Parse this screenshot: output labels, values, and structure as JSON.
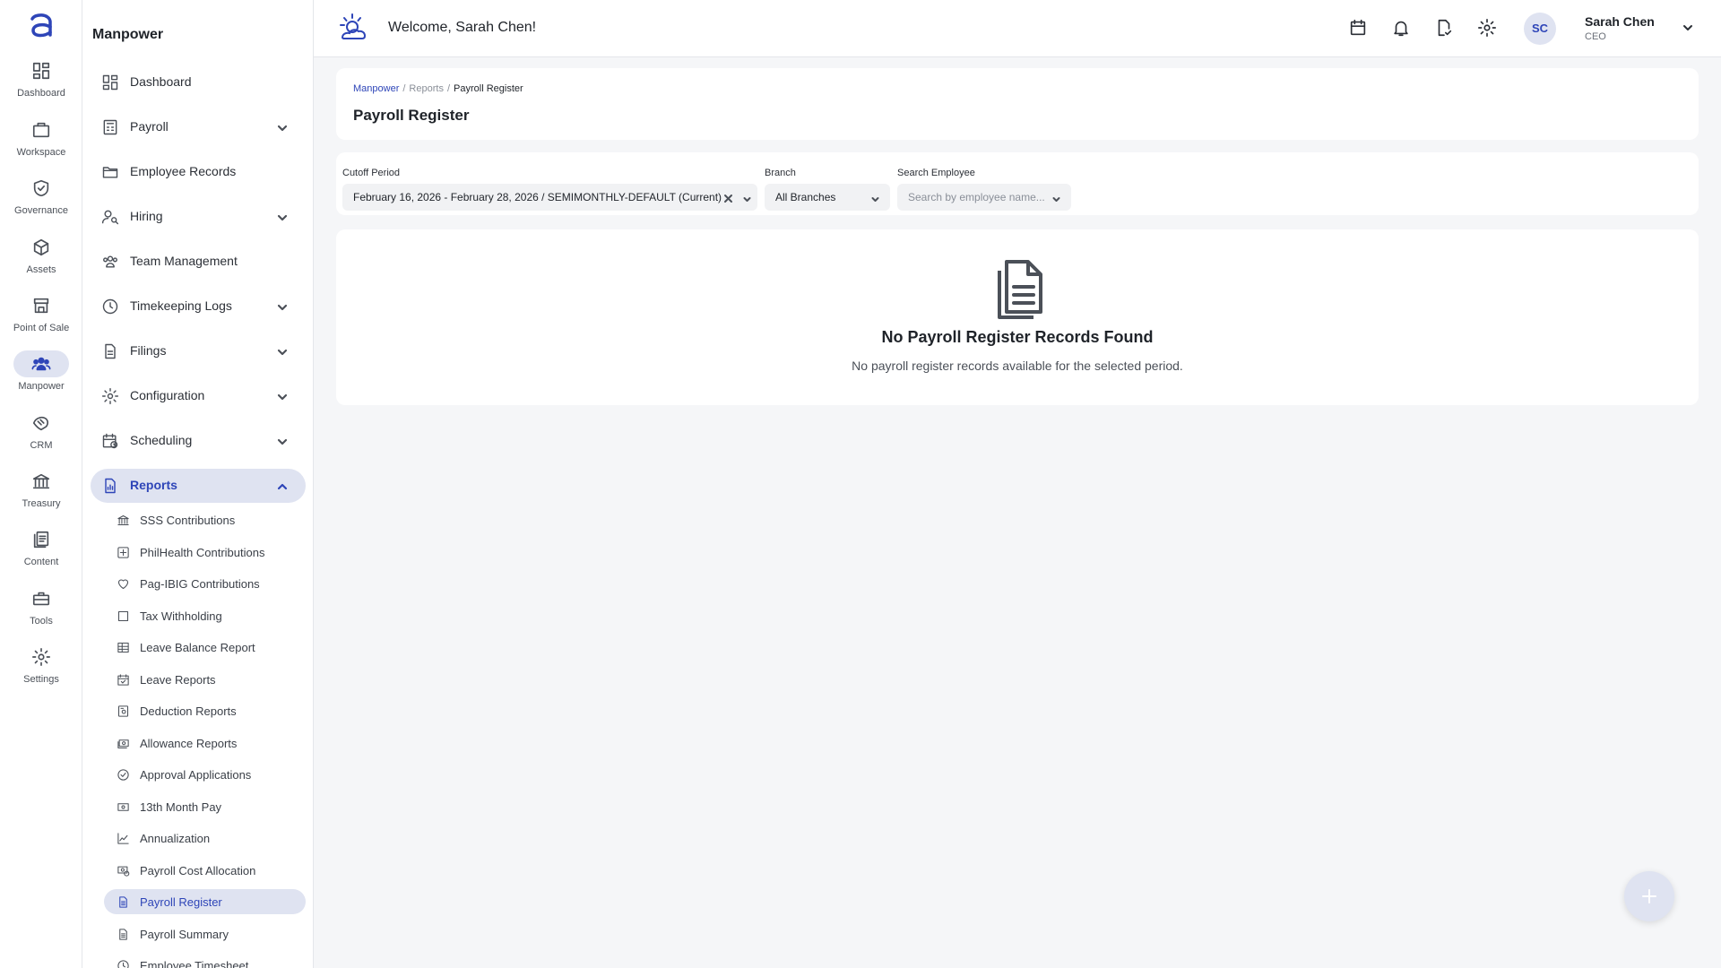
{
  "rail": {
    "items": [
      {
        "label": "Dashboard",
        "icon": "dashboard-icon"
      },
      {
        "label": "Workspace",
        "icon": "briefcase-icon"
      },
      {
        "label": "Governance",
        "icon": "shield-check-icon"
      },
      {
        "label": "Assets",
        "icon": "cube-icon"
      },
      {
        "label": "Point of Sale",
        "icon": "store-icon"
      },
      {
        "label": "Manpower",
        "icon": "people-icon"
      },
      {
        "label": "CRM",
        "icon": "handshake-icon"
      },
      {
        "label": "Treasury",
        "icon": "bank-icon"
      },
      {
        "label": "Content",
        "icon": "documents-icon"
      },
      {
        "label": "Tools",
        "icon": "toolbox-icon"
      },
      {
        "label": "Settings",
        "icon": "gear-icon"
      }
    ],
    "active": "Manpower"
  },
  "sidebar": {
    "title": "Manpower",
    "items": [
      {
        "label": "Dashboard",
        "icon": "dashboard-icon",
        "expandable": false
      },
      {
        "label": "Payroll",
        "icon": "calculator-icon",
        "expandable": true
      },
      {
        "label": "Employee Records",
        "icon": "folder-icon",
        "expandable": false
      },
      {
        "label": "Hiring",
        "icon": "person-search-icon",
        "expandable": true
      },
      {
        "label": "Team Management",
        "icon": "group-icon",
        "expandable": false
      },
      {
        "label": "Timekeeping Logs",
        "icon": "clock-icon",
        "expandable": true
      },
      {
        "label": "Filings",
        "icon": "file-icon",
        "expandable": true
      },
      {
        "label": "Configuration",
        "icon": "gear-icon",
        "expandable": true
      },
      {
        "label": "Scheduling",
        "icon": "calendar-clock-icon",
        "expandable": true
      },
      {
        "label": "Reports",
        "icon": "report-icon",
        "expandable": true,
        "expanded": true
      }
    ],
    "report_items": [
      {
        "label": "SSS Contributions",
        "icon": "bank-icon"
      },
      {
        "label": "PhilHealth Contributions",
        "icon": "medical-icon"
      },
      {
        "label": "Pag-IBIG Contributions",
        "icon": "heart-icon"
      },
      {
        "label": "Tax Withholding",
        "icon": "square-icon"
      },
      {
        "label": "Leave Balance Report",
        "icon": "table-icon"
      },
      {
        "label": "Leave Reports",
        "icon": "calendar-check-icon"
      },
      {
        "label": "Deduction Reports",
        "icon": "receipt-icon"
      },
      {
        "label": "Allowance Reports",
        "icon": "money-icon"
      },
      {
        "label": "Approval Applications",
        "icon": "check-circle-icon"
      },
      {
        "label": "13th Month Pay",
        "icon": "cash-icon"
      },
      {
        "label": "Annualization",
        "icon": "line-chart-icon"
      },
      {
        "label": "Payroll Cost Allocation",
        "icon": "cost-allocation-icon"
      },
      {
        "label": "Payroll Register",
        "icon": "document-icon"
      },
      {
        "label": "Payroll Summary",
        "icon": "document-icon"
      },
      {
        "label": "Employee Timesheet",
        "icon": "clock-icon"
      }
    ],
    "active_report": "Payroll Register"
  },
  "header": {
    "welcome": "Welcome, Sarah Chen!",
    "user": {
      "initials": "SC",
      "name": "Sarah Chen",
      "role": "CEO"
    }
  },
  "breadcrumb": [
    "Manpower",
    "Reports",
    "Payroll Register"
  ],
  "page_title": "Payroll Register",
  "filters": {
    "cutoff_label": "Cutoff Period",
    "cutoff_value": "February 16, 2026 - February 28, 2026 / SEMIMONTHLY-DEFAULT (Current)",
    "branch_label": "Branch",
    "branch_value": "All Branches",
    "search_label": "Search Employee",
    "search_placeholder": "Search by employee name..."
  },
  "empty_state": {
    "title": "No Payroll Register Records Found",
    "description": "No payroll register records available for the selected period."
  },
  "colors": {
    "accent": "#2e45b8",
    "active_bg": "#dfe3f1"
  }
}
